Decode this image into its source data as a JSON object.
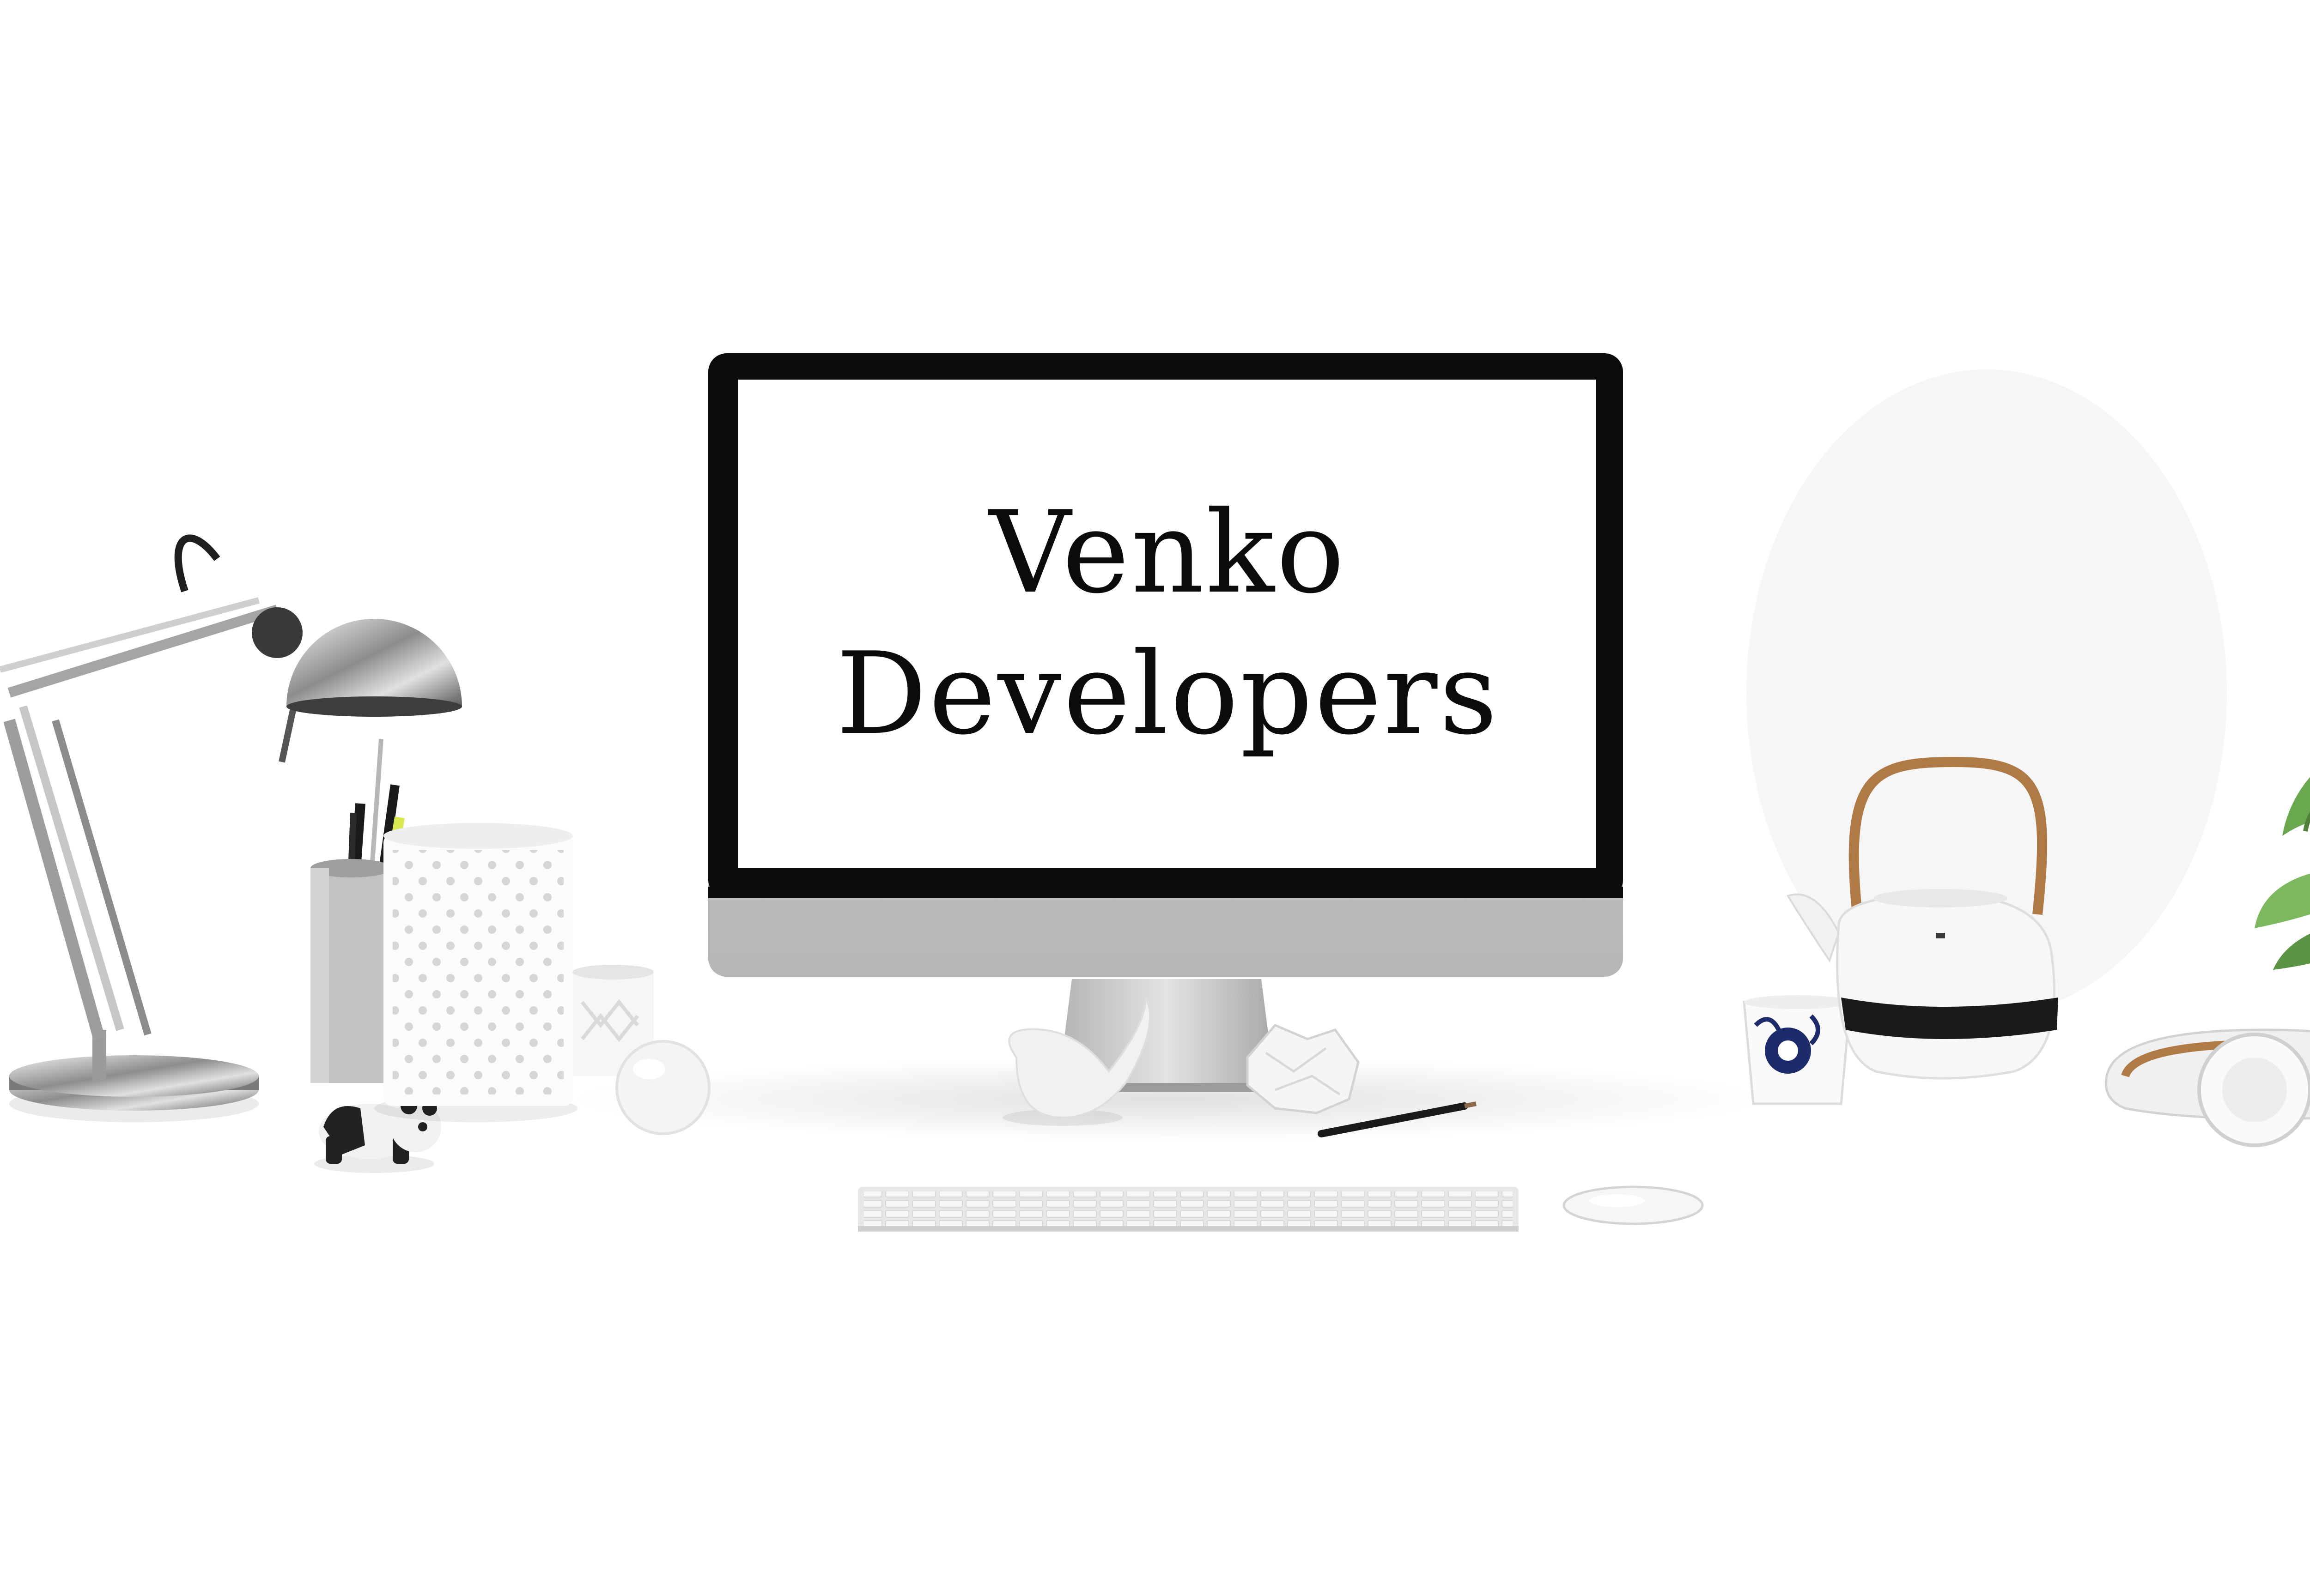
{
  "screen": {
    "line1": "Venko",
    "line2": "Developers"
  },
  "objects": [
    "desk-lamp-icon",
    "panda-figurine-icon",
    "pencil-cup-icon",
    "perforated-vase-icon",
    "small-candle-holder-icon",
    "glass-sphere-icon",
    "computer-monitor-icon",
    "bird-figurine-icon",
    "crumpled-paper-icon",
    "pencil-icon",
    "keyboard-icon",
    "mouse-icon",
    "tea-cup-icon",
    "teapot-icon",
    "headphones-icon",
    "plant-icon"
  ],
  "colors": {
    "background": "#ffffff",
    "monitor_bezel": "#0b0b0b",
    "monitor_chin": "#c9c9c9",
    "screen": "#ffffff",
    "text": "#0b0b0b",
    "plant": "#6aa84f",
    "wood": "#b07a47"
  }
}
